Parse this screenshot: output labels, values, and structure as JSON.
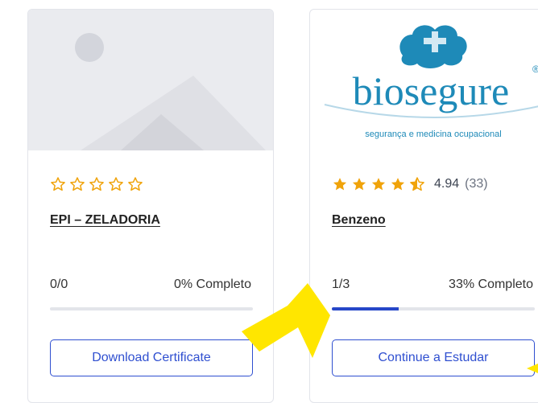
{
  "cards": [
    {
      "title": "EPI – ZELADORIA",
      "rating": 0,
      "progress_count": "0/0",
      "progress_text": "0% Completo",
      "progress_fraction": 0,
      "button_label": "Download Certificate",
      "thumbnail": "image-placeholder-icon"
    },
    {
      "title": "Benzeno",
      "rating": 4.5,
      "rating_value": "4.94",
      "rating_count": "(33)",
      "progress_count": "1/3",
      "progress_text": "33% Completo",
      "progress_fraction": 0.33,
      "button_label": "Continue a Estudar",
      "thumbnail": "biosegure-logo",
      "logo": {
        "brand": "biosegure",
        "tagline": "segurança e medicina ocupacional",
        "registered": "®"
      }
    }
  ],
  "colors": {
    "star": "#f0a30a",
    "accent": "#2f4fd0",
    "progress_fill": "#2747c8",
    "arrow": "#ffe600",
    "logo_teal": "#1e8ab8"
  },
  "annotations": [
    "yellow-arrow-pointer-icon",
    "yellow-arrow-pointer-icon"
  ]
}
